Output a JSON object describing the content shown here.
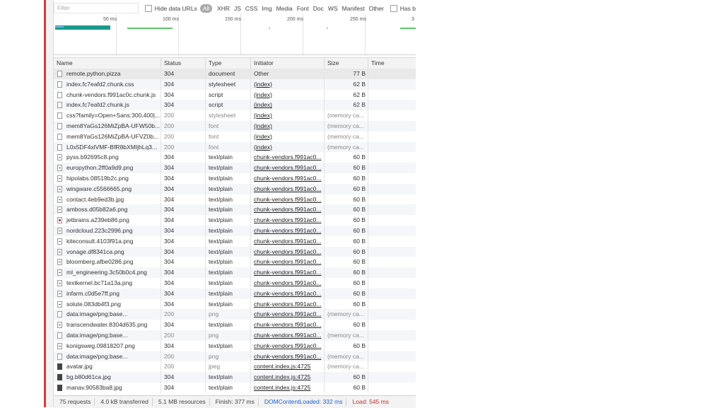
{
  "filter": {
    "placeholder": "Filter"
  },
  "toolbar": {
    "hide_data_urls": "Hide data URLs",
    "types": [
      "All",
      "XHR",
      "JS",
      "CSS",
      "Img",
      "Media",
      "Font",
      "Doc",
      "WS",
      "Manifest",
      "Other"
    ],
    "has_blocked": "Has b"
  },
  "overview": {
    "ticks": [
      "50 ms",
      "100 ms",
      "150 ms",
      "200 ms",
      "250 ms",
      "3"
    ]
  },
  "columns": {
    "name": "Name",
    "status": "Status",
    "type": "Type",
    "initiator": "Initiator",
    "size": "Size",
    "time": "Time"
  },
  "rows": [
    {
      "name": "remote.python.pizza",
      "status": "304",
      "type": "document",
      "initiator": "Other",
      "size": "77 B",
      "icon": "doc"
    },
    {
      "name": "index.fc7eafd2.chunk.css",
      "status": "304",
      "type": "stylesheet",
      "initiator": "(index)",
      "size": "62 B",
      "icon": "doc"
    },
    {
      "name": "chunk-vendors.f991ac0c.chunk.js",
      "status": "304",
      "type": "script",
      "initiator": "(index)",
      "size": "62 B",
      "icon": "doc"
    },
    {
      "name": "index.fc7eafd2.chunk.js",
      "status": "304",
      "type": "script",
      "initiator": "(index)",
      "size": "62 B",
      "icon": "doc"
    },
    {
      "name": "css?family=Open+Sans:300,400|...",
      "status": "200",
      "type": "stylesheet",
      "initiator": "(index)",
      "size": "(memory ca...",
      "icon": "doc"
    },
    {
      "name": "mem8YaGs126MiZpBA-UFW50b...",
      "status": "200",
      "type": "font",
      "initiator": "(index)",
      "size": "(memory ca...",
      "icon": "doc"
    },
    {
      "name": "mem8YaGs126MiZpBA-UFVZ0b...",
      "status": "200",
      "type": "font",
      "initiator": "(index)",
      "size": "(memory ca...",
      "icon": "doc"
    },
    {
      "name": "L0x5DF4xlVMF-BfR8bXMIjhLq3...",
      "status": "200",
      "type": "font",
      "initiator": "(index)",
      "size": "(memory ca...",
      "icon": "doc"
    },
    {
      "name": "pyss.b92695c8.png",
      "status": "304",
      "type": "text/plain",
      "initiator": "chunk-vendors.f991ac0...",
      "size": "60 B",
      "icon": "img"
    },
    {
      "name": "europython.2ff0a9d9.png",
      "status": "304",
      "type": "text/plain",
      "initiator": "chunk-vendors.f991ac0...",
      "size": "60 B",
      "icon": "img"
    },
    {
      "name": "hipolabs.08519b2c.png",
      "status": "304",
      "type": "text/plain",
      "initiator": "chunk-vendors.f991ac0...",
      "size": "60 B",
      "icon": "img"
    },
    {
      "name": "wingware.c5566665.png",
      "status": "304",
      "type": "text/plain",
      "initiator": "chunk-vendors.f991ac0...",
      "size": "60 B",
      "icon": "img"
    },
    {
      "name": "contact.4eb9ed3b.jpg",
      "status": "304",
      "type": "text/plain",
      "initiator": "chunk-vendors.f991ac0...",
      "size": "60 B",
      "icon": "img"
    },
    {
      "name": "amboss.d05b82a6.png",
      "status": "304",
      "type": "text/plain",
      "initiator": "chunk-vendors.f991ac0...",
      "size": "60 B",
      "icon": "img"
    },
    {
      "name": "jetbrains.a239eb86.png",
      "status": "304",
      "type": "text/plain",
      "initiator": "chunk-vendors.f991ac0...",
      "size": "60 B",
      "icon": "imgc"
    },
    {
      "name": "nordcloud.223c2996.png",
      "status": "304",
      "type": "text/plain",
      "initiator": "chunk-vendors.f991ac0...",
      "size": "60 B",
      "icon": "img"
    },
    {
      "name": "kiteconsult.4103f91a.png",
      "status": "304",
      "type": "text/plain",
      "initiator": "chunk-vendors.f991ac0...",
      "size": "60 B",
      "icon": "img"
    },
    {
      "name": "vonage.df8341ca.png",
      "status": "304",
      "type": "text/plain",
      "initiator": "chunk-vendors.f991ac0...",
      "size": "60 B",
      "icon": "img"
    },
    {
      "name": "bloomberg.afbe0286.png",
      "status": "304",
      "type": "text/plain",
      "initiator": "chunk-vendors.f991ac0...",
      "size": "60 B",
      "icon": "img"
    },
    {
      "name": "ml_engineering.3c50b0c4.png",
      "status": "304",
      "type": "text/plain",
      "initiator": "chunk-vendors.f991ac0...",
      "size": "60 B",
      "icon": "img"
    },
    {
      "name": "textkernel.bc71a13a.png",
      "status": "304",
      "type": "text/plain",
      "initiator": "chunk-vendors.f991ac0...",
      "size": "60 B",
      "icon": "img"
    },
    {
      "name": "infarm.c0d5e7ff.png",
      "status": "304",
      "type": "text/plain",
      "initiator": "chunk-vendors.f991ac0...",
      "size": "60 B",
      "icon": "img"
    },
    {
      "name": "solute.083db4f3.png",
      "status": "304",
      "type": "text/plain",
      "initiator": "chunk-vendors.f991ac0...",
      "size": "60 B",
      "icon": "img"
    },
    {
      "name": "data:image/png;base...",
      "status": "200",
      "type": "png",
      "initiator": "chunk-vendors.f991ac0...",
      "size": "(memory ca...",
      "icon": "doc"
    },
    {
      "name": "transcendwater.8304d635.png",
      "status": "304",
      "type": "text/plain",
      "initiator": "chunk-vendors.f991ac0...",
      "size": "60 B",
      "icon": "img"
    },
    {
      "name": "data:image/png;base...",
      "status": "200",
      "type": "png",
      "initiator": "chunk-vendors.f991ac0...",
      "size": "(memory ca...",
      "icon": "doc"
    },
    {
      "name": "konigsweg.09818207.png",
      "status": "304",
      "type": "text/plain",
      "initiator": "chunk-vendors.f991ac0...",
      "size": "60 B",
      "icon": "img"
    },
    {
      "name": "data:image/png;base...",
      "status": "200",
      "type": "png",
      "initiator": "chunk-vendors.f991ac0...",
      "size": "(memory ca...",
      "icon": "doc"
    },
    {
      "name": "avatar.jpg",
      "status": "200",
      "type": "jpeg",
      "initiator": "content.index.js:4725",
      "size": "(memory ca...",
      "icon": "dark"
    },
    {
      "name": "bg.b80d61ca.jpg",
      "status": "304",
      "type": "text/plain",
      "initiator": "content.index.js:4725",
      "size": "60 B",
      "icon": "dark"
    },
    {
      "name": "manav.90583ba8.jpg",
      "status": "304",
      "type": "text/plain",
      "initiator": "content.index.js:4725",
      "size": "60 B",
      "icon": "dark"
    }
  ],
  "statusbar": {
    "requests": "75 requests",
    "transferred": "4.0 kB transferred",
    "resources": "5.1 MB resources",
    "finish": "Finish: 377 ms",
    "dom_content_loaded": "DOMContentLoaded: 332 ms",
    "load": "Load: 545 ms"
  },
  "colors": {
    "accent_red": "#d93a3a",
    "dcl_blue": "#1a62c9",
    "load_red": "#c92a2a",
    "bar_teal": "#1a9a8a",
    "bar_green": "#5ec46a"
  }
}
